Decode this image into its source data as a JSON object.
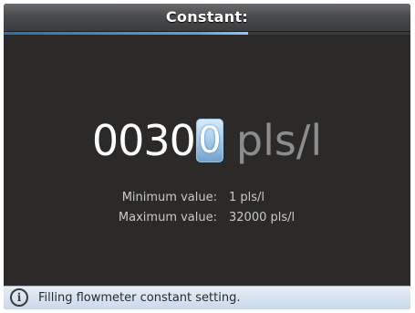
{
  "header": {
    "title": "Constant:"
  },
  "progress": {
    "fraction": 0.6
  },
  "value_editor": {
    "digits": "0030",
    "active_digit": "0",
    "unit": "pls/l"
  },
  "limits": {
    "min_label": "Minimum value:",
    "min_value": "1 pls/l",
    "max_label": "Maximum value:",
    "max_value": "32000 pls/l"
  },
  "status": {
    "icon": "info-icon",
    "icon_glyph": "i",
    "message": "Filling flowmeter constant setting."
  },
  "colors": {
    "background": "#2b2a29",
    "accent": "#5aa3e6",
    "status_bar": "#d6e2ef"
  }
}
